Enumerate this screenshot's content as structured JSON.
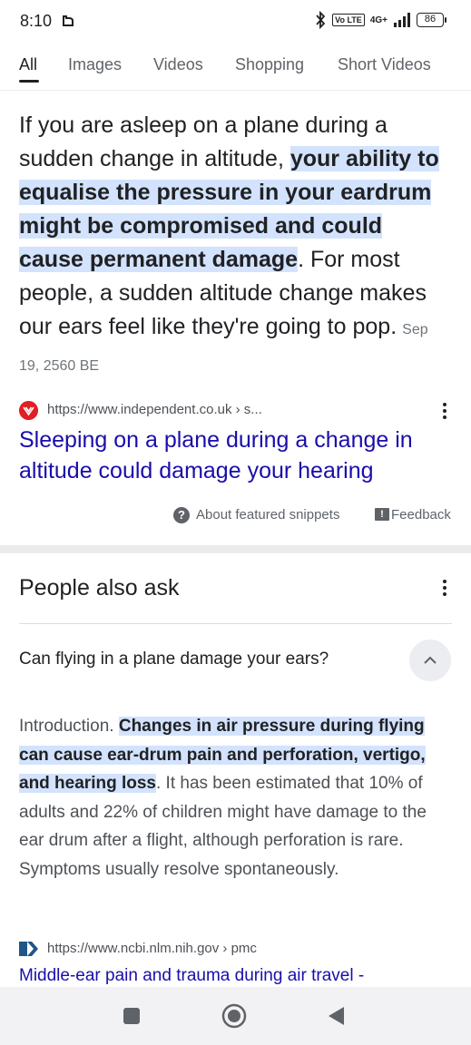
{
  "status_bar": {
    "time": "8:10",
    "volte_label": "Vo LTE",
    "network_label": "4G+",
    "battery_level": "86"
  },
  "tabs": [
    {
      "label": "All",
      "active": true
    },
    {
      "label": "Images",
      "active": false
    },
    {
      "label": "Videos",
      "active": false
    },
    {
      "label": "Shopping",
      "active": false
    },
    {
      "label": "Short Videos",
      "active": false
    }
  ],
  "snippet": {
    "text_before": "If you are asleep on a plane during a sudden change in altitude, ",
    "text_highlight": "your ability to equalise the pressure in your eardrum might be compromised and could cause permanent damage",
    "text_after": ". For most people, a sudden altitude change makes our ears feel like they're going to pop.",
    "date": "Sep 19, 2560 BE",
    "source_url": "https://www.independent.co.uk › s...",
    "link_title": "Sleeping on a plane during a change in altitude could damage your hearing",
    "about_label": "About featured snippets",
    "feedback_label": "Feedback"
  },
  "people_also_ask": {
    "title": "People also ask",
    "question": "Can flying in a plane damage your ears?",
    "answer_intro": "Introduction. ",
    "answer_highlight": "Changes in air pressure during flying can cause ear-drum pain and perforation, vertigo, and hearing loss",
    "answer_rest": ". It has been estimated that 10% of adults and 22% of children might have damage to the ear drum after a flight, although perforation is rare. Symptoms usually resolve spontaneously.",
    "source_url": "https://www.ncbi.nlm.nih.gov › pmc",
    "link_title": "Middle-ear pain and trauma during air travel -"
  },
  "icons": {
    "status_app": "app-notification-icon",
    "bluetooth": "bluetooth-icon",
    "signal": "signal-icon",
    "favicon_independent": "independent-favicon-icon",
    "favicon_ncbi": "ncbi-favicon-icon",
    "more": "more-vert-icon",
    "help": "help-icon",
    "feedback": "feedback-icon",
    "chevron": "chevron-up-icon",
    "nav_recents": "recents-icon",
    "nav_home": "home-icon",
    "nav_back": "back-icon"
  },
  "colors": {
    "highlight": "#d3e3fd",
    "link": "#1a0dab",
    "text": "#202124",
    "secondary_text": "#4d5156"
  }
}
